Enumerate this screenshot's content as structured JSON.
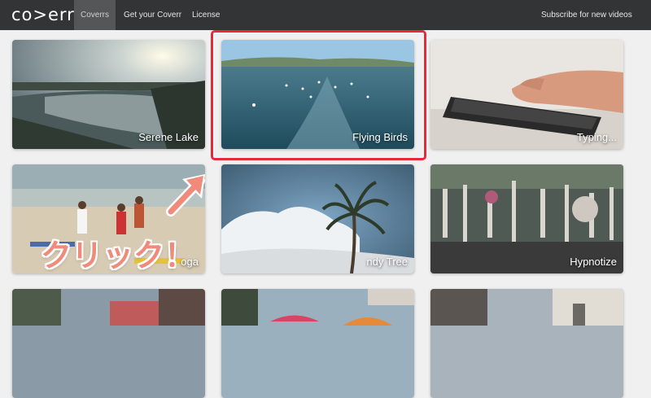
{
  "nav": {
    "logo": "co>err",
    "items": [
      {
        "label": "Coverrs",
        "active": true
      },
      {
        "label": "Get your Coverr"
      },
      {
        "label": "License"
      }
    ],
    "subscribe": "Subscribe for new videos"
  },
  "tiles": [
    {
      "label": "Serene Lake"
    },
    {
      "label": "Flying Birds"
    },
    {
      "label": "Typing..."
    },
    {
      "label": "oga"
    },
    {
      "label": "ndy Tree"
    },
    {
      "label": "Hypnotize"
    },
    {
      "label": ""
    },
    {
      "label": ""
    },
    {
      "label": ""
    }
  ],
  "annotation": {
    "text": "クリック！"
  },
  "colors": {
    "highlight": "#e8283b",
    "nav_bg": "#333435"
  }
}
